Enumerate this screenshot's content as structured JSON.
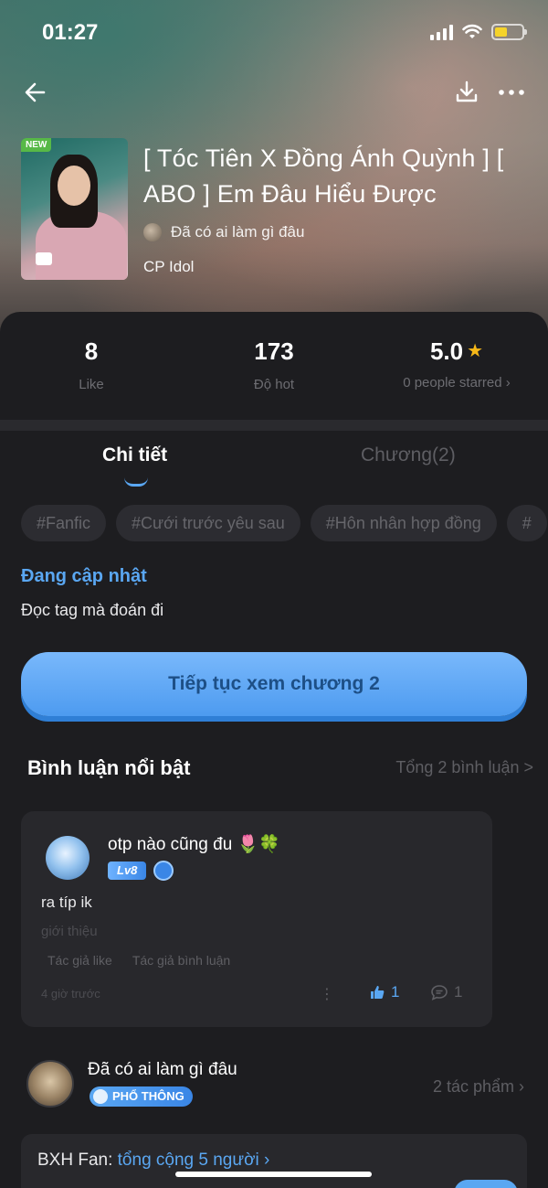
{
  "status": {
    "time": "01:27"
  },
  "nav": {
    "back_icon": "arrow-left-icon",
    "download_icon": "download-icon",
    "more_icon": "more-horizontal-icon"
  },
  "story": {
    "cover_badge": "NEW",
    "title": "[ Tóc Tiên X Đồng Ánh Quỳnh ] [ ABO ] Em Đâu Hiểu Được",
    "author": "Đã có ai làm gì đâu",
    "category": "CP Idol"
  },
  "stats": {
    "likes": {
      "value": "8",
      "label": "Like"
    },
    "hot": {
      "value": "173",
      "label": "Độ hot"
    },
    "rating": {
      "value": "5.0",
      "label": "0 people starred ›"
    }
  },
  "tabs": {
    "details": "Chi tiết",
    "chapters": "Chương(2)"
  },
  "tags": [
    "#Fanfic",
    "#Cưới trước yêu sau",
    "#Hôn nhân hợp đồng",
    "#"
  ],
  "update": {
    "label": "Đang cập nhật",
    "description": "Đọc tag mà đoán đi"
  },
  "cta": {
    "label": "Tiếp tục xem chương 2"
  },
  "comments": {
    "title": "Bình luận nổi bật",
    "count_label": "Tổng 2 bình luận >",
    "items": [
      {
        "user": "otp nào cũng đu 🌷🍀",
        "level": "Lv8",
        "text": "ra típ ik",
        "intro": "giới thiệu",
        "meta": [
          "Tác giả like",
          "Tác giả bình luận"
        ],
        "time": "4 giờ trước",
        "likes": "1",
        "replies": "1"
      }
    ]
  },
  "author_block": {
    "name": "Đã có ai làm gì đâu",
    "badge": "PHỔ THÔNG",
    "works": "2 tác phẩm ›"
  },
  "fan": {
    "label": "BXH Fan:",
    "link": "tổng cộng 5 người ›"
  },
  "colors": {
    "accent": "#5aa7f2",
    "star": "#f6b818",
    "background": "#1d1d20",
    "card": "#28282c"
  }
}
